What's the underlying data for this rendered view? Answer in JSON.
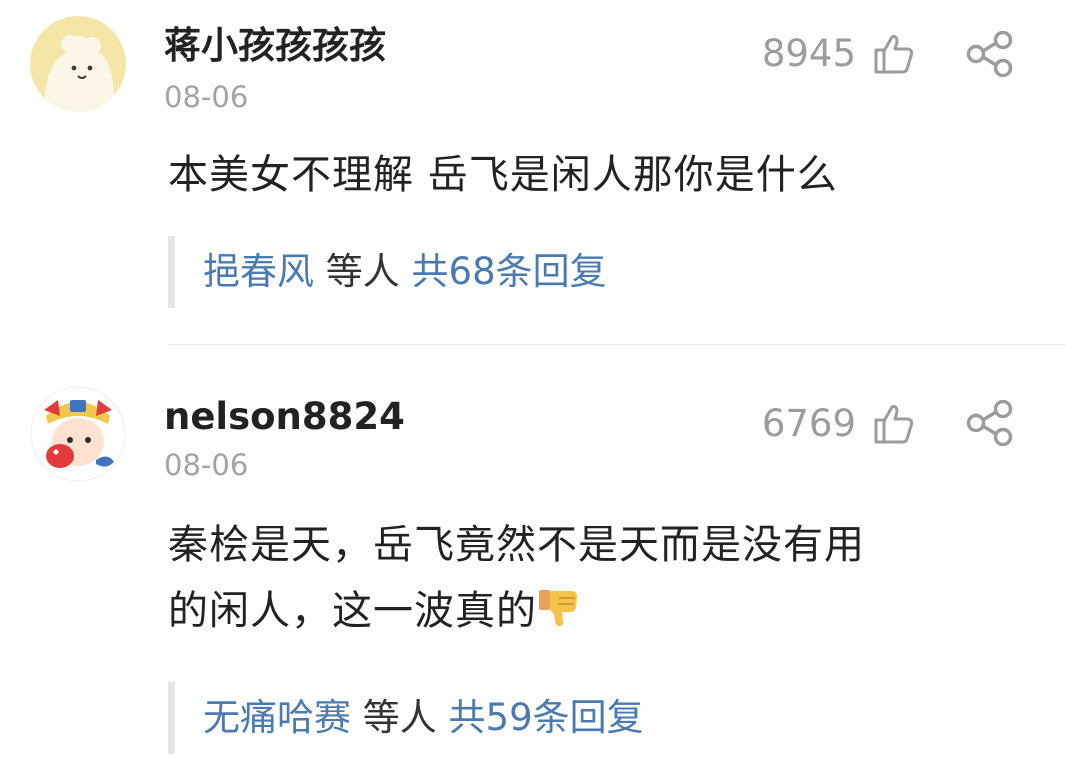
{
  "comments": [
    {
      "avatar": "cartoon-bear-avatar",
      "username": "蒋小孩孩孩孩",
      "date": "08-06",
      "likes": "8945",
      "text": "本美女不理解 岳飞是闲人那你是什么",
      "text_suffix_emoji": "",
      "reply_users": "挹春风",
      "reply_mid": " 等人 ",
      "reply_total": "共68条回复"
    },
    {
      "avatar": "cartoon-boy-with-fish-avatar",
      "username": "nelson8824",
      "date": "08-06",
      "likes": "6769",
      "text_line1": "秦桧是天，岳飞竟然不是天而是没有用",
      "text_line2": "的闲人，这一波真的",
      "text_suffix_emoji": "thumbs-down-emoji",
      "reply_users": "无痛哈赛",
      "reply_mid": " 等人 ",
      "reply_total": "共59条回复"
    }
  ],
  "icons": {
    "like": "thumbs-up-outline-icon",
    "share": "share-icon"
  },
  "colors": {
    "link": "#4a7ab0",
    "muted": "#a3a3a3",
    "text": "#222222",
    "avatar1_bg": "#f4e6a6"
  }
}
